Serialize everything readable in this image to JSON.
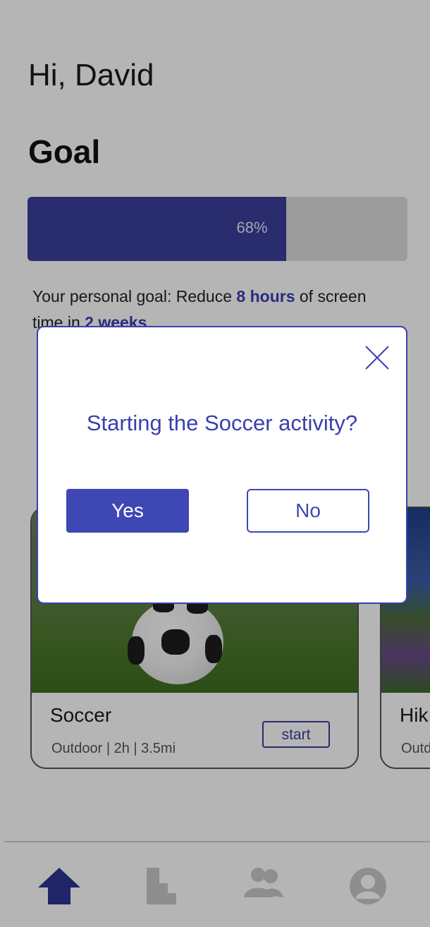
{
  "header": {
    "greeting": "Hi, David"
  },
  "goal": {
    "title": "Goal",
    "progress_percent": 68,
    "progress_label": "68%",
    "text_prefix": "Your personal goal: Reduce ",
    "hours": "8 hours",
    "text_middle": " of screen time in ",
    "period": "2 weeks",
    "text_suffix": "."
  },
  "activities": [
    {
      "title": "Soccer",
      "meta": "Outdoor | 2h | 3.5mi",
      "start_label": "start"
    },
    {
      "title": "Hik",
      "meta": "Outd"
    }
  ],
  "modal": {
    "question": "Starting the Soccer activity?",
    "yes_label": "Yes",
    "no_label": "No"
  },
  "nav": {
    "items": [
      "home-icon",
      "stats-icon",
      "friends-icon",
      "profile-icon"
    ],
    "active_color": "#2d3592",
    "inactive_color": "#c9c9c9"
  },
  "colors": {
    "accent": "#3f47b4",
    "progress_fill": "#3a3f9a"
  }
}
